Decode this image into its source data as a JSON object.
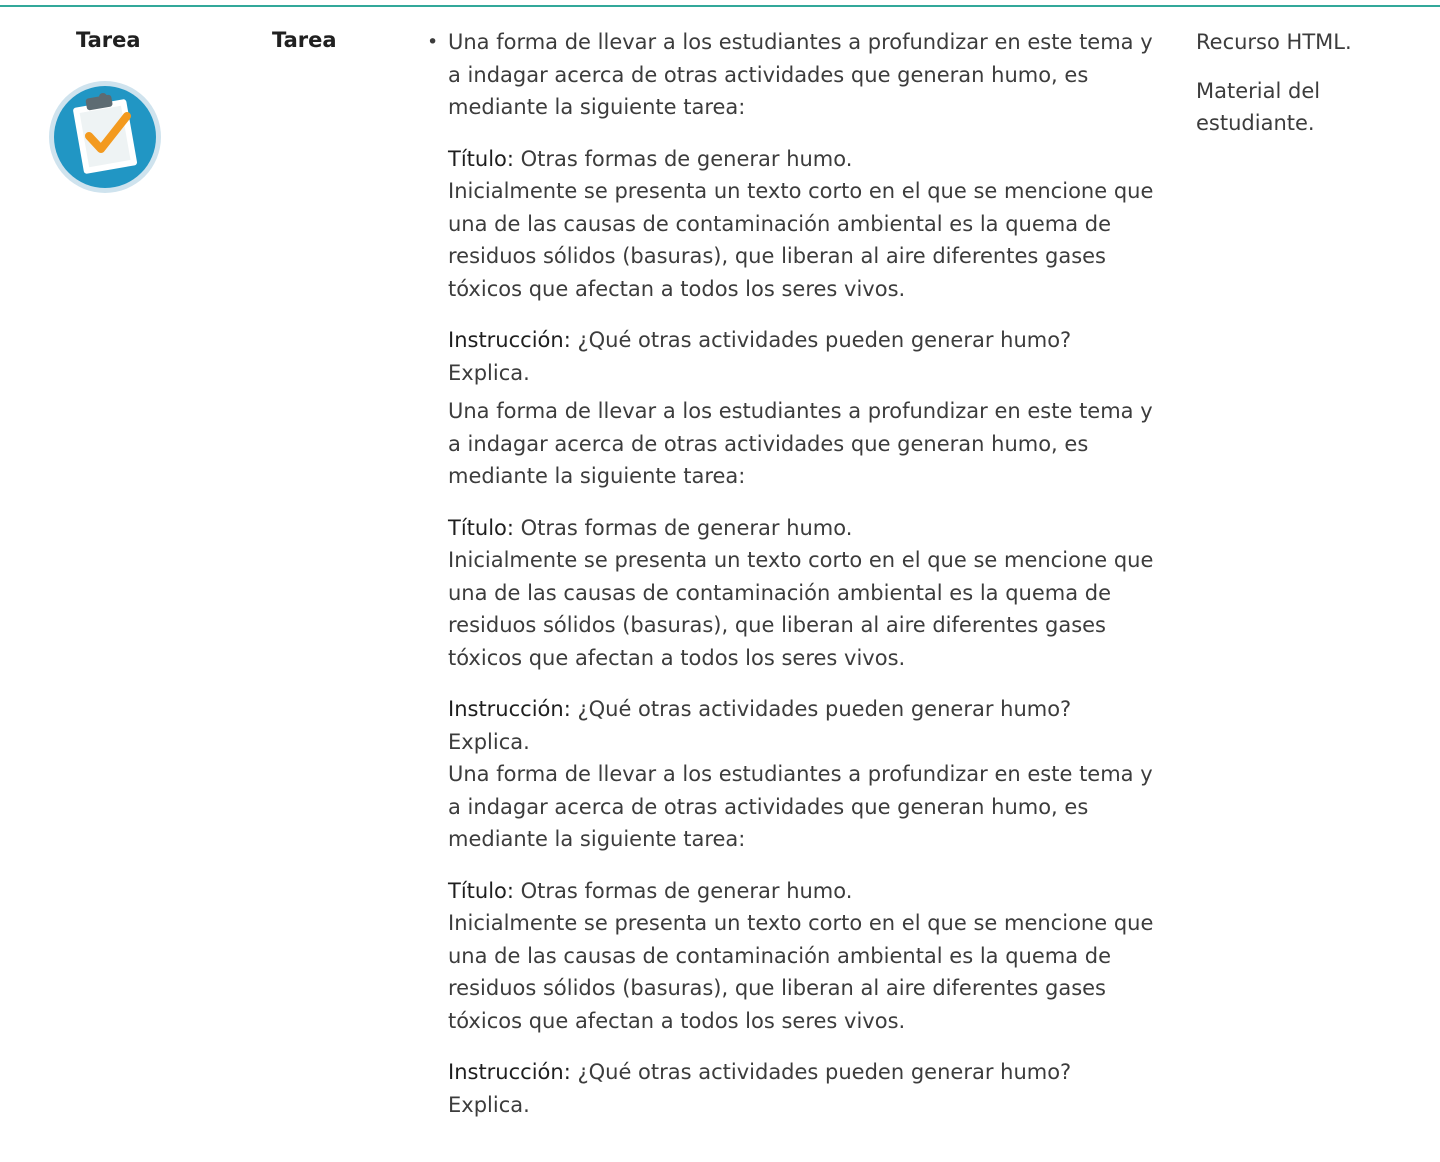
{
  "row": {
    "type_label": "Tarea",
    "name_label": "Tarea",
    "icon": "clipboard-check-icon",
    "colors": {
      "accent_rule": "#33a89a",
      "icon_circle": "#2196c4",
      "icon_ring": "#cfe3ee",
      "check": "#f39a1f"
    }
  },
  "content": {
    "blocks": [
      {
        "intro": "Una forma de llevar a los estudiantes a profundizar en este tema y a indagar acerca de otras actividades que generan humo, es mediante la siguiente tarea:",
        "title_label": "Título:",
        "title_text": " Otras formas de generar humo.",
        "body": "Inicialmente se presenta un texto corto en el que se mencione que una de las causas de contaminación ambiental es la quema de residuos sólidos (basuras), que liberan al aire diferentes gases tóxicos que afectan a todos los seres vivos.",
        "instruction_label": "Instrucción:",
        "instruction_text": " ¿Qué otras actividades pueden generar humo? Explica."
      },
      {
        "intro": "Una forma de llevar a los estudiantes a profundizar en este tema y a indagar acerca de otras actividades que generan humo, es mediante la siguiente tarea:",
        "title_label": "Título:",
        "title_text": " Otras formas de generar humo.",
        "body": "Inicialmente se presenta un texto corto en el que se mencione que una de las causas de contaminación ambiental es la quema de residuos sólidos (basuras), que liberan al aire diferentes gases tóxicos que afectan a todos los seres vivos.",
        "instruction_label": "Instrucción:",
        "instruction_text": " ¿Qué otras actividades pueden generar humo? Explica."
      },
      {
        "intro": "Una forma de llevar a los estudiantes a profundizar en este tema y a indagar acerca de otras actividades que generan humo, es mediante la siguiente tarea:",
        "title_label": "Título:",
        "title_text": " Otras formas de generar humo.",
        "body": "Inicialmente se presenta un texto corto en el que se mencione que una de las causas de contaminación ambiental es la quema de residuos sólidos (basuras), que liberan al aire diferentes gases tóxicos que afectan a todos los seres vivos.",
        "instruction_label": "Instrucción:",
        "instruction_text": " ¿Qué otras actividades pueden generar humo? Explica."
      }
    ]
  },
  "resources": {
    "items": [
      "Recurso HTML.",
      "Material del estudiante."
    ]
  }
}
